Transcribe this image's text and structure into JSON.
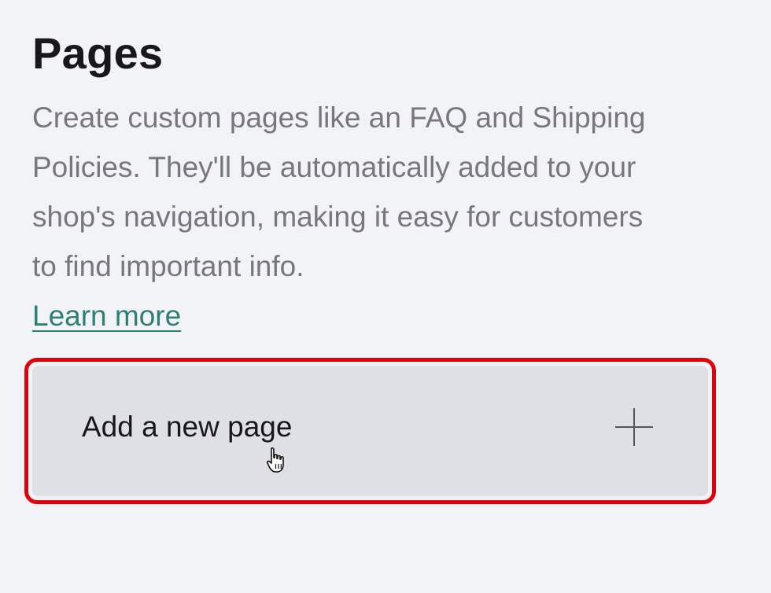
{
  "pages_section": {
    "title": "Pages",
    "description": "Create custom pages like an FAQ and Shipping Policies. They'll be automatically added to your shop's navigation, making it easy for customers to find important info.",
    "learn_more_label": "Learn more"
  },
  "add_page": {
    "label": "Add a new page",
    "icon": "plus-icon",
    "highlight_color": "#e1000a",
    "background_color": "#dfe0e5"
  },
  "cursor": {
    "icon": "hand-pointer-icon"
  },
  "colors": {
    "background": "#f2f3f7",
    "title": "#18181b",
    "description": "#77777d",
    "link": "#2f7f73"
  }
}
